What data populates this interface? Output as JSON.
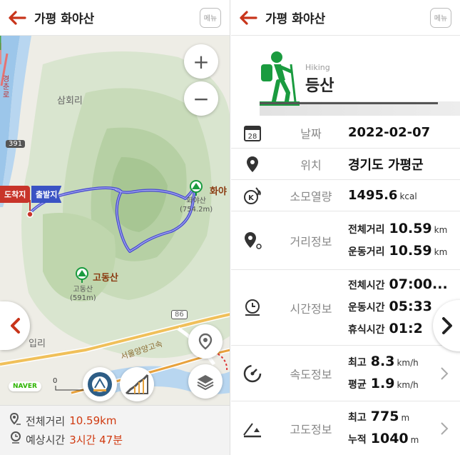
{
  "left_screen": {
    "header": {
      "title": "가평 화야산",
      "menu_label": "메뉴"
    },
    "map": {
      "labels": {
        "samhoe": "삼회리",
        "road_391": "391",
        "road_86": "86",
        "ipri": "입리",
        "expressway": "서울양양고속",
        "vertical_road": "경춘로",
        "hwayasan_name": "화야",
        "hwayasan_detail": "화야산\n(754.2m)",
        "godongsan_name": "고동산",
        "godongsan_detail": "고동산\n(591m)",
        "arrival_flag": "도착지",
        "departure_flag": "출발지",
        "naver": "NAVER",
        "scale_zero": "0"
      },
      "zoom_in": "+",
      "zoom_out": "−"
    },
    "bottom": {
      "distance_label": "전체거리",
      "distance_value": "10.59km",
      "time_label": "예상시간",
      "time_value": "3시간 47분"
    }
  },
  "right_screen": {
    "header": {
      "title": "가평 화야산",
      "menu_label": "메뉴"
    },
    "hero": {
      "subtitle": "Hiking",
      "title": "등산"
    },
    "rows": {
      "date": {
        "label": "날짜",
        "value": "2022-02-07",
        "icon_day": "28"
      },
      "location": {
        "label": "위치",
        "value": "경기도 가평군"
      },
      "calories": {
        "label": "소모열량",
        "value": "1495.6",
        "unit": "kcal"
      },
      "distance": {
        "label": "거리정보",
        "total_key": "전체거리",
        "total_value": "10.59",
        "total_unit": "km",
        "moving_key": "운동거리",
        "moving_value": "10.59",
        "moving_unit": "km"
      },
      "time": {
        "label": "시간정보",
        "total_key": "전체시간",
        "total_value": "07:00...",
        "moving_key": "운동시간",
        "moving_value": "05:33",
        "rest_key": "휴식시간",
        "rest_value": "01:2"
      },
      "speed": {
        "label": "속도정보",
        "max_key": "최고",
        "max_value": "8.3",
        "max_unit": "km/h",
        "avg_key": "평균",
        "avg_value": "1.9",
        "avg_unit": "km/h"
      },
      "altitude": {
        "label": "고도정보",
        "max_key": "최고",
        "max_value": "775",
        "max_unit": "m",
        "cum_key": "누적",
        "cum_value": "1040",
        "cum_unit": "m"
      }
    }
  },
  "colors": {
    "accent": "#d03a10",
    "green": "#1a9b3f",
    "route": "#4b4fd0"
  }
}
